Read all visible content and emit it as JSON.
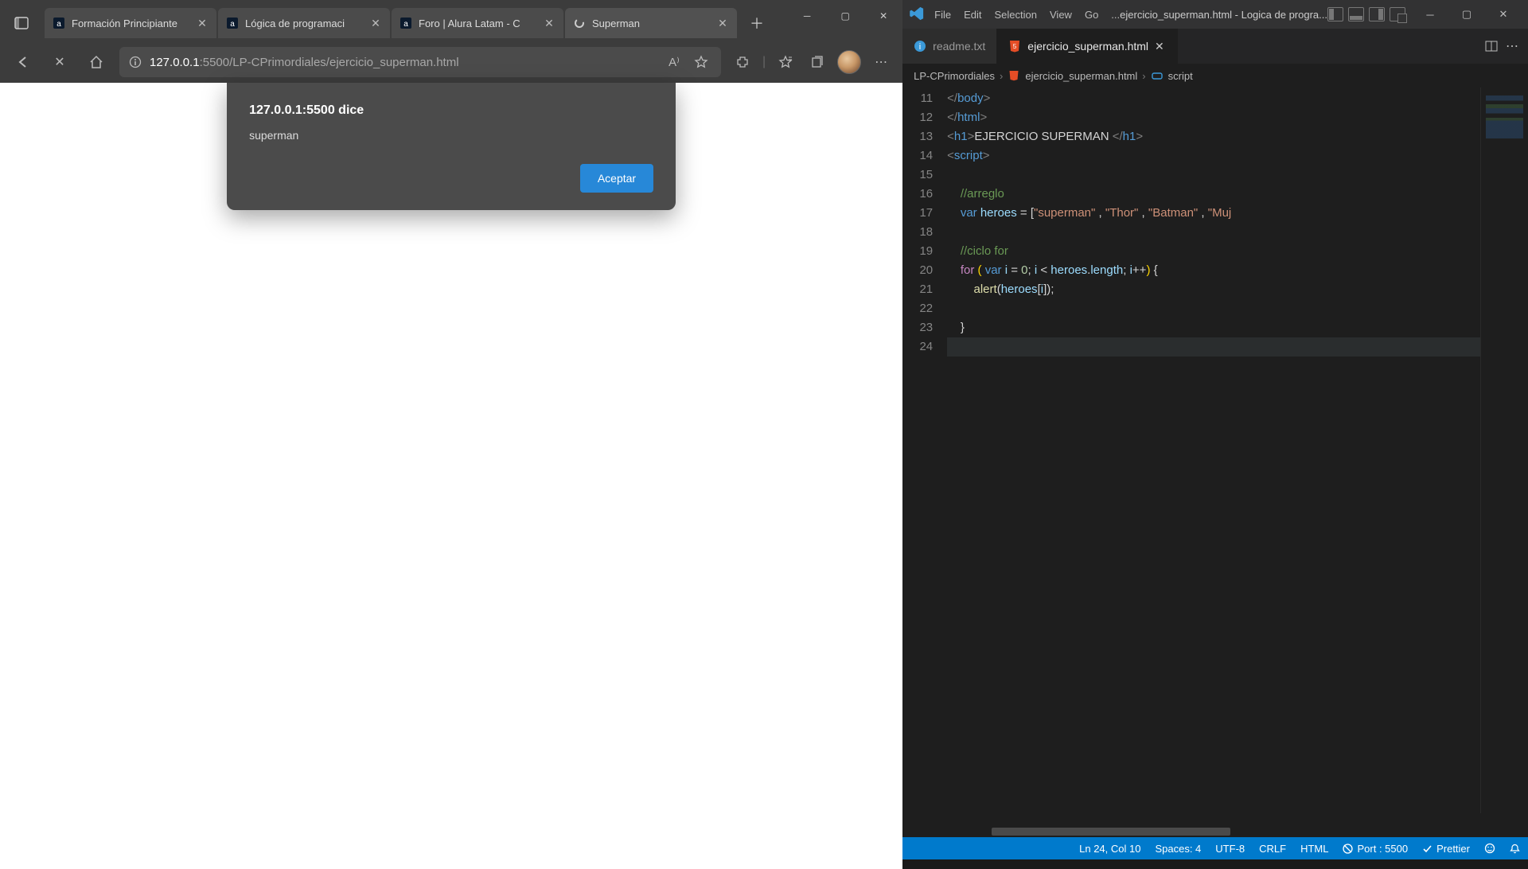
{
  "browser": {
    "tabs": [
      {
        "label": "Formación Principiante"
      },
      {
        "label": "Lógica de programaci"
      },
      {
        "label": "Foro | Alura Latam - C"
      },
      {
        "label": "Superman"
      }
    ],
    "active_tab_index": 3,
    "url_host": "127.0.0.1",
    "url_port": ":5500",
    "url_path": "/LP-CPrimordiales/ejercicio_superman.html",
    "alert": {
      "title": "127.0.0.1:5500 dice",
      "message": "superman",
      "accept": "Aceptar"
    }
  },
  "vscode": {
    "menus": [
      "File",
      "Edit",
      "Selection",
      "View",
      "Go",
      "..."
    ],
    "window_title": "ejercicio_superman.html - Logica de progra...",
    "tabs": [
      {
        "label": "readme.txt",
        "icon": "info"
      },
      {
        "label": "ejercicio_superman.html",
        "icon": "html",
        "active": true
      }
    ],
    "breadcrumb": {
      "root": "LP-CPrimordiales",
      "file": "ejercicio_superman.html",
      "symbol": "script"
    },
    "statusbar": {
      "cursor": "Ln 24, Col 10",
      "spaces": "Spaces: 4",
      "encoding": "UTF-8",
      "eol": "CRLF",
      "lang": "HTML",
      "port": "Port : 5500",
      "prettier": "Prettier"
    },
    "code": {
      "first_line": 11,
      "highlight_line": 24,
      "heroes": [
        "superman",
        "Thor",
        "Batman",
        "Muj"
      ],
      "h1_text": "EJERCICIO SUPERMAN ",
      "comment_array": "//arreglo",
      "comment_for": "//ciclo for",
      "array_var": "heroes",
      "loop_var": "i",
      "loop_start": "0",
      "loop_cond_obj": "heroes",
      "loop_cond_prop": "length",
      "alert_fn": "alert"
    }
  }
}
